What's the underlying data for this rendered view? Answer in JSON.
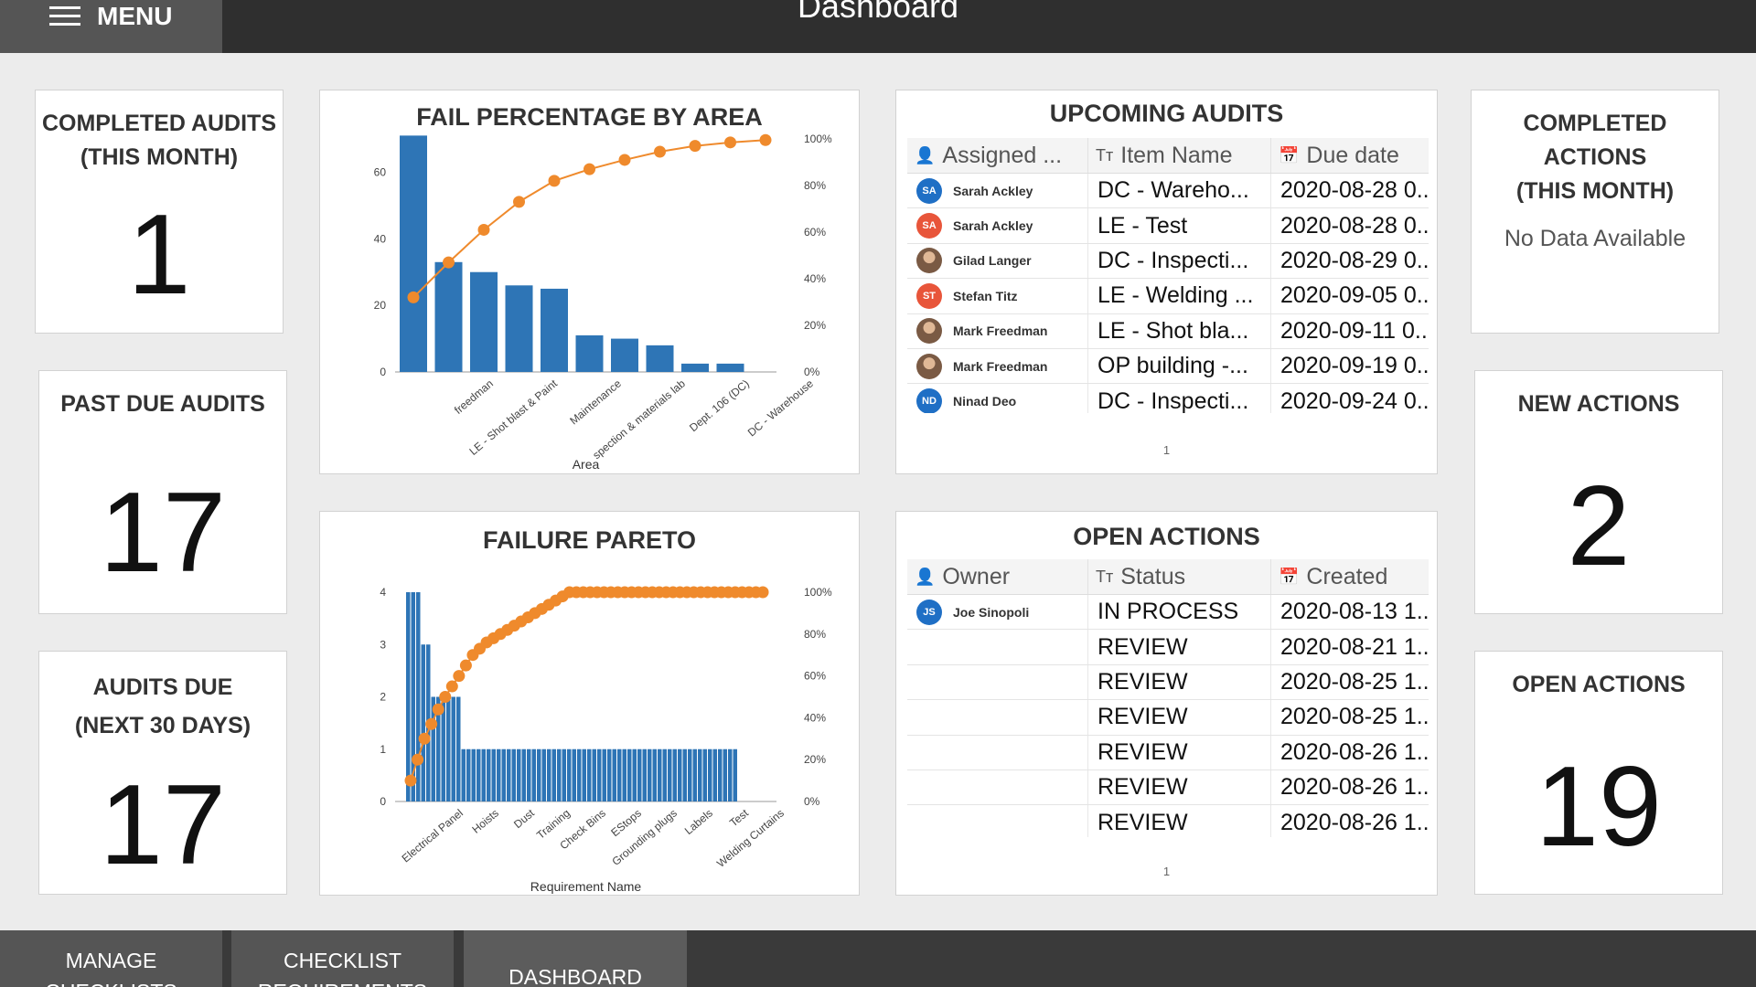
{
  "header": {
    "menu_label": "MENU",
    "title": "Dashboard"
  },
  "kpis": {
    "completed_audits": {
      "title_line1": "COMPLETED AUDITS",
      "title_line2": "(THIS MONTH)",
      "value": "1"
    },
    "past_due_audits": {
      "title_line1": "PAST DUE AUDITS",
      "value": "17"
    },
    "audits_due": {
      "title_line1": "AUDITS DUE",
      "title_line2": "(NEXT 30 DAYS)",
      "value": "17"
    },
    "completed_actions": {
      "title_line1": "COMPLETED ACTIONS",
      "title_line2": "(THIS MONTH)",
      "empty_text": "No Data Available"
    },
    "new_actions": {
      "title_line1": "NEW ACTIONS",
      "value": "2"
    },
    "open_actions": {
      "title_line1": "OPEN ACTIONS",
      "value": "19"
    }
  },
  "upcoming_audits": {
    "title": "UPCOMING AUDITS",
    "columns": [
      "Assigned ...",
      "Item Name",
      "Due date"
    ],
    "rows": [
      {
        "initials": "SA",
        "avatar_color": "#1f6fc5",
        "assigned": "Sarah Ackley",
        "item": "DC - Wareho...",
        "due": "2020-08-28 0.."
      },
      {
        "initials": "SA",
        "avatar_color": "#e8553a",
        "assigned": "Sarah Ackley",
        "item": "LE - Test",
        "due": "2020-08-28 0.."
      },
      {
        "initials": "",
        "avatar_color": "photo",
        "assigned": "Gilad Langer",
        "item": "DC - Inspecti...",
        "due": "2020-08-29 0.."
      },
      {
        "initials": "ST",
        "avatar_color": "#e8553a",
        "assigned": "Stefan Titz",
        "item": "LE - Welding ...",
        "due": "2020-09-05 0.."
      },
      {
        "initials": "",
        "avatar_color": "photo",
        "assigned": "Mark Freedman",
        "item": "LE - Shot bla...",
        "due": "2020-09-11 0.."
      },
      {
        "initials": "",
        "avatar_color": "photo",
        "assigned": "Mark Freedman",
        "item": "OP building -...",
        "due": "2020-09-19 0.."
      },
      {
        "initials": "ND",
        "avatar_color": "#1f6fc5",
        "assigned": "Ninad Deo",
        "item": "DC - Inspecti...",
        "due": "2020-09-24 0.."
      }
    ],
    "page": "1"
  },
  "open_actions_table": {
    "title": "OPEN ACTIONS",
    "columns": [
      "Owner",
      "Status",
      "Created"
    ],
    "rows": [
      {
        "initials": "JS",
        "avatar_color": "#1f6fc5",
        "owner": "Joe Sinopoli",
        "status": "IN PROCESS",
        "created": "2020-08-13 1.."
      },
      {
        "initials": "",
        "avatar_color": "",
        "owner": "",
        "status": "REVIEW",
        "created": "2020-08-21 1.."
      },
      {
        "initials": "",
        "avatar_color": "",
        "owner": "",
        "status": "REVIEW",
        "created": "2020-08-25 1.."
      },
      {
        "initials": "",
        "avatar_color": "",
        "owner": "",
        "status": "REVIEW",
        "created": "2020-08-25 1.."
      },
      {
        "initials": "",
        "avatar_color": "",
        "owner": "",
        "status": "REVIEW",
        "created": "2020-08-26 1.."
      },
      {
        "initials": "",
        "avatar_color": "",
        "owner": "",
        "status": "REVIEW",
        "created": "2020-08-26 1.."
      },
      {
        "initials": "",
        "avatar_color": "",
        "owner": "",
        "status": "REVIEW",
        "created": "2020-08-26 1.."
      }
    ],
    "page": "1"
  },
  "chart_data": [
    {
      "type": "bar",
      "title": "FAIL PERCENTAGE BY AREA",
      "xlabel": "Area",
      "ylabel": "",
      "ylim": [
        0,
        70
      ],
      "yticks": [
        0,
        20,
        40,
        60
      ],
      "y2lim": [
        0,
        100
      ],
      "y2ticks": [
        "0%",
        "20%",
        "40%",
        "60%",
        "80%",
        "100%"
      ],
      "tick_labels": [
        "freedman",
        "LE - Shot blast & Paint",
        "Maintenance",
        "spection & materials lab",
        "Dept. 106 (DC)",
        "DC - Warehouse"
      ],
      "bar_color": "#2e75b6",
      "line_color": "#ef8a2c",
      "values": [
        71,
        33,
        30,
        26,
        25,
        11,
        10,
        8,
        2.5,
        2.5
      ],
      "cumulative_pct": [
        32,
        47,
        61,
        73,
        82,
        87,
        91,
        94.5,
        97,
        98.5,
        99.5
      ]
    },
    {
      "type": "bar",
      "title": "FAILURE PARETO",
      "xlabel": "Requirement Name",
      "ylabel": "",
      "ylim": [
        0,
        4
      ],
      "yticks": [
        0,
        1,
        2,
        3,
        4
      ],
      "y2lim": [
        0,
        100
      ],
      "y2ticks": [
        "0%",
        "20%",
        "40%",
        "60%",
        "80%",
        "100%"
      ],
      "tick_labels": [
        "Electrical Panel",
        "Hoists",
        "Dust",
        "Training",
        "Check Bins",
        "EStops",
        "Grounding plugs",
        "Labels",
        "Test",
        "Welding Curtains"
      ],
      "bar_color": "#2e75b6",
      "line_color": "#ef8a2c",
      "values": [
        4,
        4,
        4,
        3,
        3,
        2,
        2,
        2,
        2,
        2,
        2,
        1,
        1,
        1,
        1,
        1,
        1,
        1,
        1,
        1,
        1,
        1,
        1,
        1,
        1,
        1,
        1,
        1,
        1,
        1,
        1,
        1,
        1,
        1,
        1,
        1,
        1,
        1,
        1,
        1,
        1,
        1,
        1,
        1,
        1,
        1,
        1,
        1,
        1,
        1,
        1,
        1,
        1,
        1,
        1,
        1,
        1,
        1,
        1,
        1,
        1,
        1,
        1,
        1,
        1,
        1
      ],
      "cumulative_pct": [
        10,
        20,
        30,
        37,
        44,
        50,
        55,
        60,
        65,
        70,
        73,
        76,
        78,
        80,
        82,
        84,
        86,
        88,
        90,
        92,
        94,
        96,
        98,
        100,
        100,
        100,
        100,
        100,
        100,
        100,
        100,
        100,
        100,
        100,
        100,
        100,
        100,
        100,
        100,
        100,
        100,
        100,
        100,
        100,
        100,
        100,
        100,
        100,
        100,
        100,
        100,
        100
      ]
    }
  ],
  "bottom_nav": [
    {
      "line1": "MANAGE",
      "line2": "CHECKLISTS"
    },
    {
      "line1": "CHECKLIST",
      "line2": "REQUIREMENTS"
    },
    {
      "line1": "DASHBOARD",
      "line2": ""
    }
  ]
}
